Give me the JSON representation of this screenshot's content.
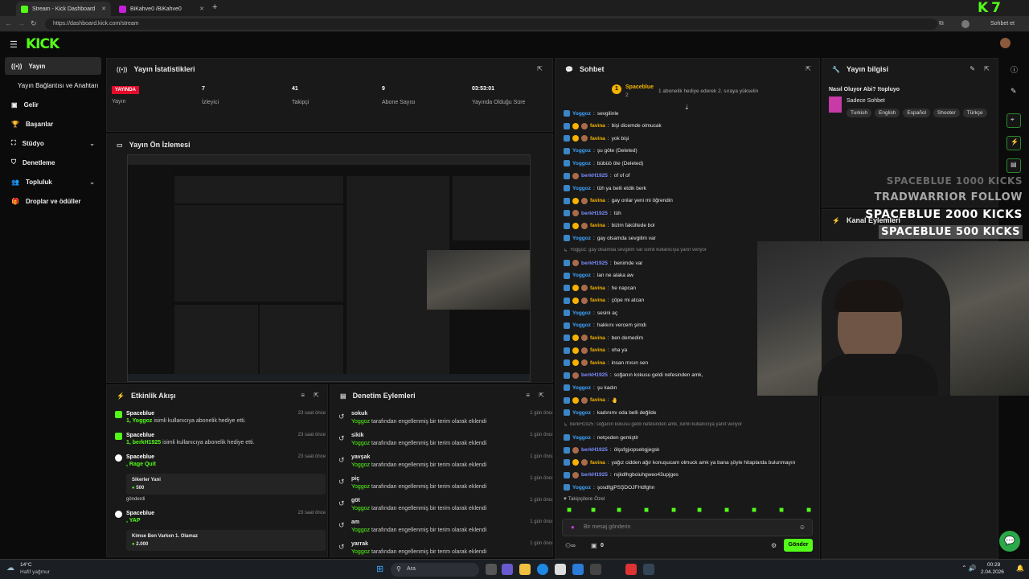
{
  "browser": {
    "tabs": [
      {
        "label": "Stream - Kick Dashboard"
      },
      {
        "label": "BiKahve0 /BiKahve0"
      }
    ],
    "url": "https://dashboard.kick.com/stream",
    "profile_label": "Sohbet et"
  },
  "overlay_logo": "K 7",
  "sidebar": {
    "items": [
      {
        "label": "Yayın"
      },
      {
        "label": "Yayın Bağlantısı ve Anahtarı"
      },
      {
        "label": "Gelir"
      },
      {
        "label": "Başarılar"
      },
      {
        "label": "Stüdyo"
      },
      {
        "label": "Denetleme"
      },
      {
        "label": "Topluluk"
      },
      {
        "label": "Droplar ve ödüller"
      }
    ]
  },
  "stats": {
    "title": "Yayın İstatistikleri",
    "live_badge": "YAYINDA",
    "status_label": "Yayın",
    "cells": [
      {
        "value": "7",
        "label": "İzleyici"
      },
      {
        "value": "41",
        "label": "Takipçi"
      },
      {
        "value": "9",
        "label": "Abone Sayısı"
      },
      {
        "value": "03:53:01",
        "label": "Yayında Olduğu Süre"
      }
    ]
  },
  "preview": {
    "title": "Yayın Ön İzlemesi"
  },
  "activity": {
    "title": "Etkinlik Akışı",
    "items": [
      {
        "name": "Spaceblue",
        "detail_user": "1, Yoggoz",
        "detail": " isimli kullanıcıya abonelik hediye etti.",
        "time": "23 saat önce"
      },
      {
        "name": "Spaceblue",
        "detail_user": "1, berkH1925",
        "detail": " isimli kullanıcıya abonelik hediye etti.",
        "time": "23 saat önce"
      },
      {
        "name": "Spaceblue",
        "detail_user": ", Rage Quit",
        "detail": "",
        "time": "23 saat önce",
        "box_title": "Sikerler Yani",
        "box_amount": "500",
        "box_note": "gönderdi"
      },
      {
        "name": "Spaceblue",
        "detail_user": ", YAP",
        "detail": "",
        "time": "23 saat önce",
        "box_title": "Kimse Ben Varken 1. Olamaz",
        "box_amount": "2.000"
      }
    ]
  },
  "moderation": {
    "title": "Denetim Eylemleri",
    "actor": "Yoggoz",
    "action_text": " tarafından engellenmiş bir terim olarak eklendi",
    "time": "1 gün önce",
    "words": [
      "sokuk",
      "sikik",
      "yavşak",
      "piç",
      "göt",
      "am",
      "yarrak"
    ]
  },
  "chat": {
    "title": "Sohbet",
    "pinned_user": "Spaceblue",
    "pinned_count": "2",
    "pinned_text": "1 abonelik hediye ederek 2. sıraya yükselin",
    "messages": [
      {
        "user": "Yoggoz",
        "text": "sevgilinle",
        "color": "#3ea6ff",
        "badges": 1
      },
      {
        "user": "favina",
        "text": "bişi dicemde olmucak",
        "color": "#f5b300",
        "badges": 3
      },
      {
        "user": "favina",
        "text": "yok bişi",
        "color": "#f5b300",
        "badges": 3
      },
      {
        "user": "Yoggoz",
        "text": "şu göte (Deleted)",
        "color": "#3ea6ff",
        "badges": 1
      },
      {
        "user": "Yoggoz",
        "text": "bübüö öte (Deleted)",
        "color": "#3ea6ff",
        "badges": 1
      },
      {
        "user": "berkH1925",
        "text": "of of of",
        "color": "#7b8cff",
        "badges": 2
      },
      {
        "user": "Yoggoz",
        "text": "tüh ya belli etdik berk",
        "color": "#3ea6ff",
        "badges": 1
      },
      {
        "user": "favina",
        "text": "gay onlar yeni mi öğrendin",
        "color": "#f5b300",
        "badges": 3
      },
      {
        "user": "berkH1925",
        "text": "tüh",
        "color": "#7b8cff",
        "badges": 2
      },
      {
        "user": "favina",
        "text": "bizim fakültede bol",
        "color": "#f5b300",
        "badges": 3
      },
      {
        "user": "Yoggoz",
        "text": "gay olsamda sevgilim var",
        "color": "#3ea6ff",
        "badges": 1
      },
      {
        "user": "",
        "text": "Yoggoz: gay olsamda sevgilim var isimli kullanıcıya yanıt veriyor",
        "color": "#888",
        "badges": 0,
        "sys": true
      },
      {
        "user": "berkH1925",
        "text": "benimde var",
        "color": "#7b8cff",
        "badges": 2
      },
      {
        "user": "Yoggoz",
        "text": "lan ne alaka aw",
        "color": "#3ea6ff",
        "badges": 1
      },
      {
        "user": "favina",
        "text": "he napcan",
        "color": "#f5b300",
        "badges": 3
      },
      {
        "user": "favina",
        "text": "çöpe mi atcan",
        "color": "#f5b300",
        "badges": 3
      },
      {
        "user": "Yoggoz",
        "text": "sesini aç",
        "color": "#3ea6ff",
        "badges": 1
      },
      {
        "user": "Yoggoz",
        "text": "hakkını vercem şimdi",
        "color": "#3ea6ff",
        "badges": 1
      },
      {
        "user": "favina",
        "text": "ben demedim",
        "color": "#f5b300",
        "badges": 3
      },
      {
        "user": "favina",
        "text": "oha ya",
        "color": "#f5b300",
        "badges": 3
      },
      {
        "user": "favina",
        "text": "insan mısın sen",
        "color": "#f5b300",
        "badges": 3
      },
      {
        "user": "berkH1925",
        "text": "soğanın kokusu geldi nefesinden amk,",
        "color": "#7b8cff",
        "badges": 2
      },
      {
        "user": "Yoggoz",
        "text": "şu kadın",
        "color": "#3ea6ff",
        "badges": 1
      },
      {
        "user": "favina",
        "text": "🤚",
        "color": "#f5b300",
        "badges": 3
      },
      {
        "user": "Yoggoz",
        "text": "kadınımı oda belli değilde",
        "color": "#3ea6ff",
        "badges": 1
      },
      {
        "user": "",
        "text": "berkH1925: soğanın kokusu geldi nefesinden amk, isimli kullanıcıya yanıt veriyor",
        "color": "#888",
        "badges": 0,
        "sys": true
      },
      {
        "user": "Yoggoz",
        "text": "netçeden gemiştir",
        "color": "#3ea6ff",
        "badges": 1
      },
      {
        "user": "berkH1925",
        "text": "ölşsfgjıopsebgjegsk",
        "color": "#7b8cff",
        "badges": 2
      },
      {
        "user": "favina",
        "text": "yağız cidden ağır konuşucam olmuck amk ya bana şöyle hitaplarda bulunmayın",
        "color": "#f5b300",
        "badges": 3
      },
      {
        "user": "berkH1925",
        "text": "rsjkdlhgboiuhgweo43upjges",
        "color": "#7b8cff",
        "badges": 2
      },
      {
        "user": "Yoggoz",
        "text": "şosdfgjPSŞDOJFHdfghn",
        "color": "#3ea6ff",
        "badges": 1
      }
    ],
    "emote_label": "Takipçilere Özel",
    "input_placeholder": "Bir mesaj gönderin",
    "points": "0",
    "send_label": "Gönder"
  },
  "info": {
    "title": "Yayın bilgisi",
    "stream_title": "Nasıl Oluyor Abi? !topluyo",
    "category": "Sadece Sohbet",
    "tags": [
      "Turkish",
      "English",
      "Español",
      "Shooter",
      "Türkçe"
    ]
  },
  "actions_panel": {
    "title": "Kanal Eylemleri"
  },
  "overlay": {
    "lines": [
      {
        "text": "SPACEBLUE 1000 KICKS",
        "color": "#6b6b6b"
      },
      {
        "text": "TRADWARRIOR FOLLOW",
        "color": "#a8a8a8"
      },
      {
        "text": "SPACEBLUE 2000 KICKS",
        "color": "#ffffff"
      },
      {
        "text": "SPACEBLUE 500 KICKS",
        "color": "#ffffff"
      }
    ]
  },
  "taskbar": {
    "weather_temp": "14°C",
    "weather_desc": "Hafif yağmur",
    "search_label": "Ara",
    "time": "00:28",
    "date": "2.04.2026"
  },
  "colors": {
    "accent": "#53fc18",
    "live": "#e30b2b",
    "panel": "#191919"
  }
}
